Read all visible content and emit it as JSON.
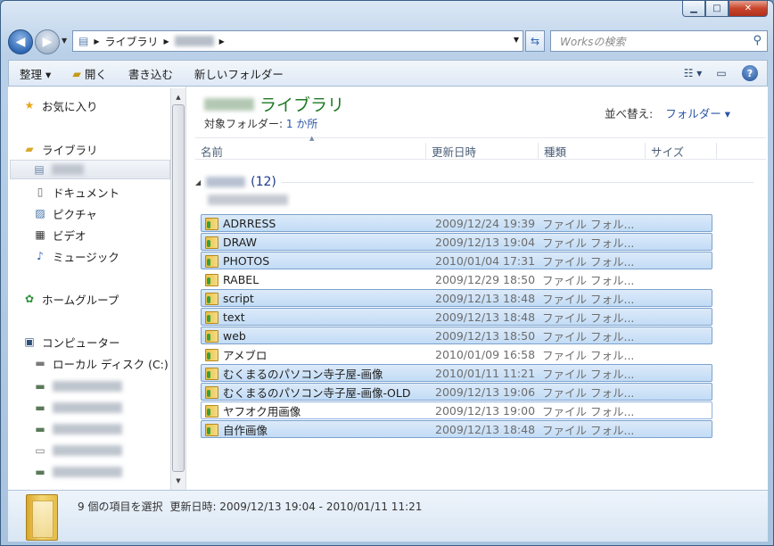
{
  "window": {
    "caption": {
      "minimize": "▁",
      "maximize": "□",
      "close": "✕"
    }
  },
  "nav": {
    "address_segments": [
      "ライブラリ"
    ],
    "search_placeholder": "Worksの検索"
  },
  "toolbar": {
    "organize": "整理 ▾",
    "open": "開く",
    "write": "書き込む",
    "new_folder": "新しいフォルダー"
  },
  "sidebar": {
    "favorites": "お気に入り",
    "libraries": "ライブラリ",
    "documents": "ドキュメント",
    "pictures": "ピクチャ",
    "videos": "ビデオ",
    "music": "ミュージック",
    "homegroup": "ホームグループ",
    "computer": "コンピューター",
    "local_disk": "ローカル ディスク (C:)"
  },
  "content": {
    "library_title": "ライブラリ",
    "target_label": "対象フォルダー:",
    "target_link": "1 か所",
    "sort_label": "並べ替え:",
    "sort_value": "フォルダー ▾",
    "columns": {
      "name": "名前",
      "date": "更新日時",
      "type": "種類",
      "size": "サイズ"
    },
    "group_count": "(12)",
    "files": [
      {
        "name": "ADRRESS",
        "date": "2009/12/24 19:39",
        "type": "ファイル フォル...",
        "selected": true
      },
      {
        "name": "DRAW",
        "date": "2009/12/13 19:04",
        "type": "ファイル フォル...",
        "selected": true
      },
      {
        "name": "PHOTOS",
        "date": "2010/01/04 17:31",
        "type": "ファイル フォル...",
        "selected": true
      },
      {
        "name": "RABEL",
        "date": "2009/12/29 18:50",
        "type": "ファイル フォル...",
        "selected": false
      },
      {
        "name": "script",
        "date": "2009/12/13 18:48",
        "type": "ファイル フォル...",
        "selected": true
      },
      {
        "name": "text",
        "date": "2009/12/13 18:48",
        "type": "ファイル フォル...",
        "selected": true
      },
      {
        "name": "web",
        "date": "2009/12/13 18:50",
        "type": "ファイル フォル...",
        "selected": true
      },
      {
        "name": "アメブロ",
        "date": "2010/01/09 16:58",
        "type": "ファイル フォル...",
        "selected": false
      },
      {
        "name": "むくまるのパソコン寺子屋-画像",
        "date": "2010/01/11 11:21",
        "type": "ファイル フォル...",
        "selected": true
      },
      {
        "name": "むくまるのパソコン寺子屋-画像-OLD",
        "date": "2009/12/13 19:06",
        "type": "ファイル フォル...",
        "selected": true
      },
      {
        "name": "ヤフオク用画像",
        "date": "2009/12/13 19:00",
        "type": "ファイル フォル...",
        "selected": false
      },
      {
        "name": "自作画像",
        "date": "2009/12/13 18:48",
        "type": "ファイル フォル...",
        "selected": true
      }
    ]
  },
  "status": {
    "selected": "9 個の項目を選択",
    "date_range": "更新日時: 2009/12/13 19:04 - 2010/01/11 11:21"
  }
}
